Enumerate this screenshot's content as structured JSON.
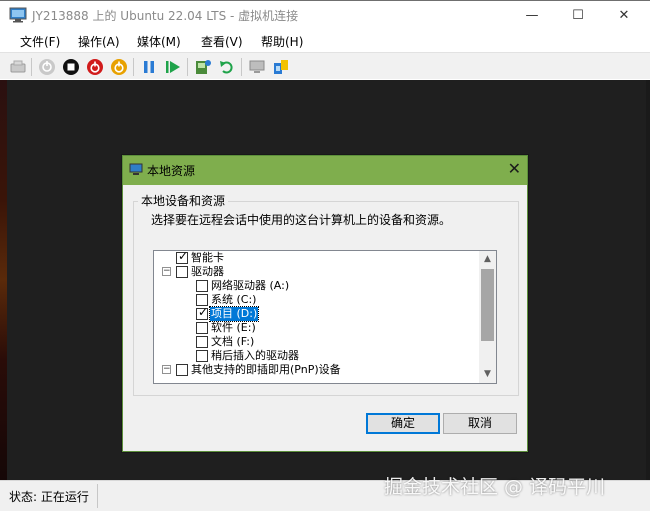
{
  "window": {
    "title": "JY213888 上的 Ubuntu 22.04 LTS - 虚拟机连接",
    "minimize_glyph": "—",
    "maximize_glyph": "☐",
    "close_glyph": "✕"
  },
  "menu": {
    "file": "文件(F)",
    "action": "操作(A)",
    "media": "媒体(M)",
    "view": "查看(V)",
    "help": "帮助(H)"
  },
  "toolbar": {
    "icons": [
      "ctrl-alt-del-icon",
      "start-icon",
      "turn-off-icon",
      "shut-down-icon",
      "save-icon",
      "pause-icon",
      "resume-icon",
      "checkpoint-icon",
      "revert-icon",
      "enhanced-session-icon",
      "share-icon"
    ]
  },
  "dialog": {
    "title": "本地资源",
    "close_glyph": "✕",
    "group_label": "本地设备和资源",
    "instruction": "选择要在远程会话中使用的这台计算机上的设备和资源。",
    "tree": [
      {
        "label": "智能卡",
        "checked": true
      },
      {
        "label": "驱动器",
        "checked": false,
        "expander": "−"
      },
      {
        "label": "网络驱动器 (A:)",
        "checked": false
      },
      {
        "label": "系统 (C:)",
        "checked": false
      },
      {
        "label": "项目 (D:)",
        "checked": true,
        "selected": true
      },
      {
        "label": "软件 (E:)",
        "checked": false
      },
      {
        "label": "文档 (F:)",
        "checked": false
      },
      {
        "label": "稍后插入的驱动器",
        "checked": false
      },
      {
        "label": "其他支持的即插即用(PnP)设备",
        "checked": false,
        "expander": "−"
      }
    ],
    "check_glyph": "✓",
    "scroll_up_glyph": "▲",
    "scroll_down_glyph": "▼",
    "ok_label": "确定",
    "cancel_label": "取消"
  },
  "status": {
    "text": "状态: 正在运行"
  },
  "watermark": "掘金技术社区 @ 译码平川",
  "colors": {
    "dialog_title_bg": "#7fae4d",
    "selection": "#0078d7",
    "vm_bg": "#1f1f1f"
  }
}
